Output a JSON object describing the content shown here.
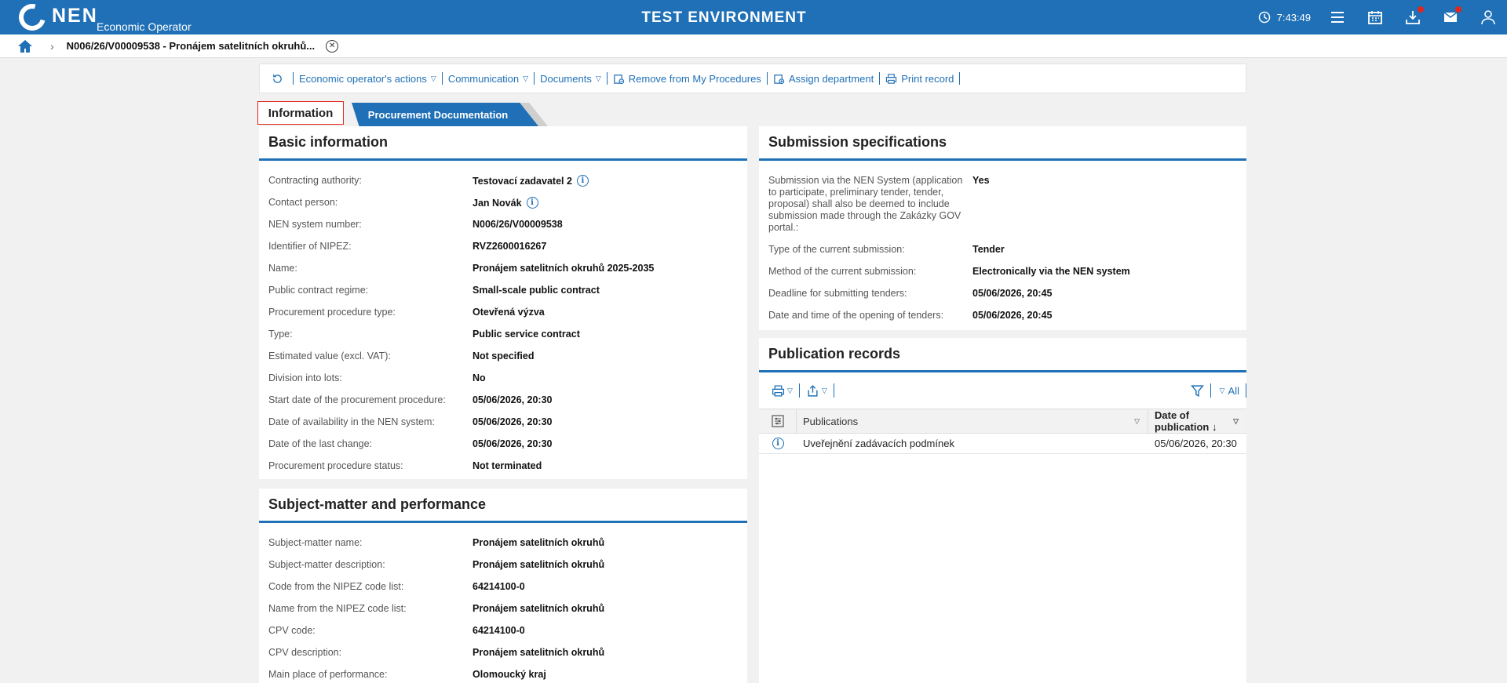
{
  "header": {
    "logo_text": "NEN",
    "logo_sub": "Economic Operator",
    "environment": "TEST ENVIRONMENT",
    "clock": "7:43:49",
    "icons": [
      "clock-icon",
      "menu-icon",
      "calendar-icon",
      "download-icon",
      "mail-icon",
      "user-icon"
    ]
  },
  "breadcrumb": {
    "current": "N006/26/V00009538 - Pronájem satelitních okruhů..."
  },
  "toolbar": {
    "eo_actions": "Economic operator's actions",
    "communication": "Communication",
    "documents": "Documents",
    "remove": "Remove from My Procedures",
    "assign": "Assign department",
    "print": "Print record"
  },
  "tabs": {
    "information": "Information",
    "documentation": "Procurement Documentation"
  },
  "basic": {
    "title": "Basic information",
    "rows": [
      {
        "label": "Contracting authority:",
        "value": "Testovací zadavatel 2"
      },
      {
        "label": "Contact person:",
        "value": "Jan Novák"
      },
      {
        "label": "NEN system number:",
        "value": "N006/26/V00009538"
      },
      {
        "label": "Identifier of NIPEZ:",
        "value": "RVZ2600016267"
      },
      {
        "label": "Name:",
        "value": "Pronájem satelitních okruhů 2025-2035"
      },
      {
        "label": "Public contract regime:",
        "value": "Small-scale public contract"
      },
      {
        "label": "Procurement procedure type:",
        "value": "Otevřená výzva"
      },
      {
        "label": "Type:",
        "value": "Public service contract"
      },
      {
        "label": "Estimated value (excl. VAT):",
        "value": "Not specified"
      },
      {
        "label": "Division into lots:",
        "value": "No"
      },
      {
        "label": "Start date of the procurement procedure:",
        "value": "05/06/2026, 20:30"
      },
      {
        "label": "Date of availability in the NEN system:",
        "value": "05/06/2026, 20:30"
      },
      {
        "label": "Date of the last change:",
        "value": "05/06/2026, 20:30"
      },
      {
        "label": "Procurement procedure status:",
        "value": "Not terminated"
      }
    ]
  },
  "subject": {
    "title": "Subject-matter and performance",
    "rows": [
      {
        "label": "Subject-matter name:",
        "value": "Pronájem satelitních okruhů"
      },
      {
        "label": "Subject-matter description:",
        "value": "Pronájem satelitních okruhů"
      },
      {
        "label": "Code from the NIPEZ code list:",
        "value": "64214100-0"
      },
      {
        "label": "Name from the NIPEZ code list:",
        "value": "Pronájem satelitních okruhů"
      },
      {
        "label": "CPV code:",
        "value": "64214100-0"
      },
      {
        "label": "CPV description:",
        "value": "Pronájem satelitních okruhů"
      },
      {
        "label": "Main place of performance:",
        "value": "Olomoucký kraj"
      }
    ]
  },
  "submission": {
    "title": "Submission specifications",
    "rows": [
      {
        "label": "Submission via the NEN System (application to participate, preliminary tender, tender, proposal) shall also be deemed to include submission made through the Zakázky GOV portal.:",
        "value": "Yes"
      },
      {
        "label": "Type of the current submission:",
        "value": "Tender"
      },
      {
        "label": "Method of the current submission:",
        "value": "Electronically via the NEN system"
      },
      {
        "label": "Deadline for submitting tenders:",
        "value": "05/06/2026, 20:45"
      },
      {
        "label": "Date and time of the opening of tenders:",
        "value": "05/06/2026, 20:45"
      }
    ]
  },
  "publication": {
    "title": "Publication records",
    "filter_all": "All",
    "col_publications": "Publications",
    "col_date": "Date of publication",
    "rows": [
      {
        "publication": "Uveřejnění zadávacích podmínek",
        "date": "05/06/2026, 20:30"
      }
    ]
  }
}
